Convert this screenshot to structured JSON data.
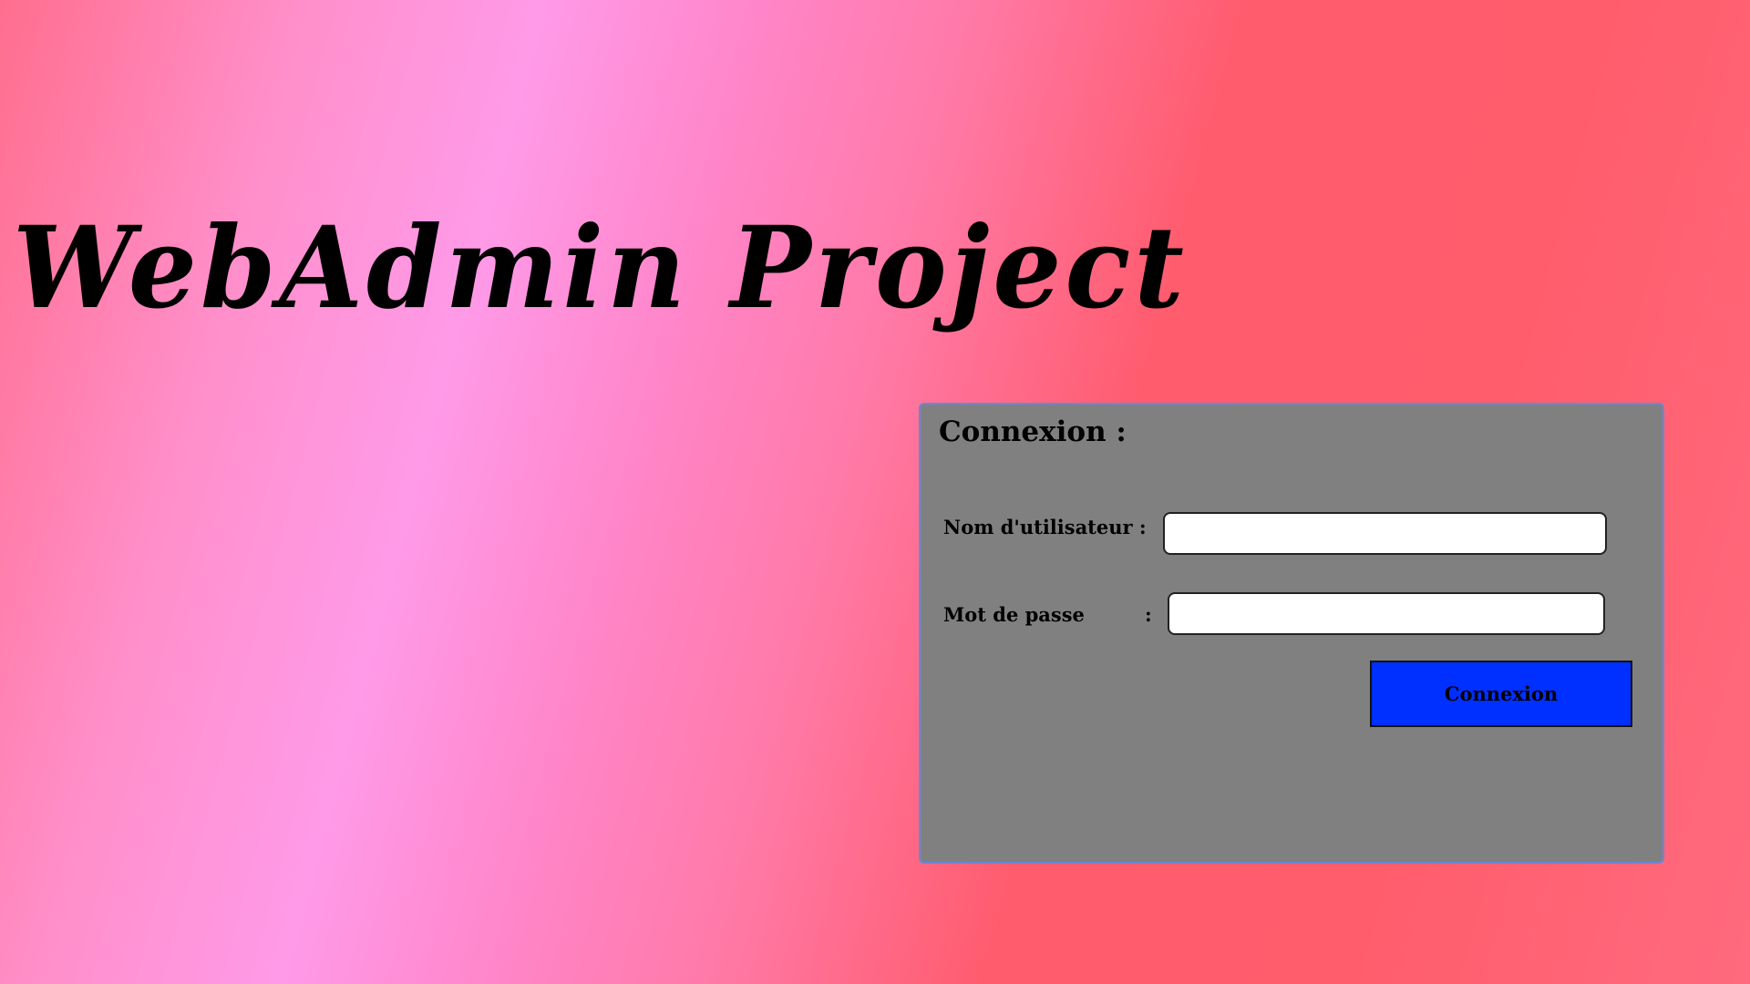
{
  "header": {
    "title": "WebAdmin Project"
  },
  "login": {
    "heading": "Connexion :",
    "username_label": "Nom d'utilisateur :",
    "username_value": "",
    "password_label": "Mot de passe",
    "password_colon": ":",
    "password_value": "",
    "submit_label": "Connexion"
  },
  "colors": {
    "panel_background": "#808080",
    "panel_border": "#6c86d8",
    "button_background": "#0030ff",
    "background_pink": "#ff9ae8",
    "background_red": "#ff5c6e"
  }
}
